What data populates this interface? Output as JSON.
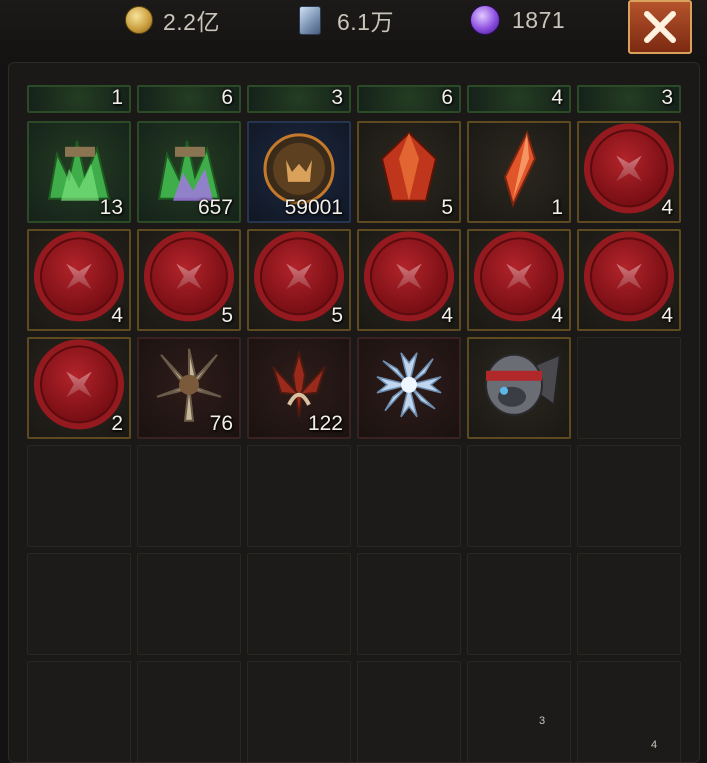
{
  "currencies": {
    "gold": {
      "icon": "gold-coin-icon",
      "value": "2.2亿"
    },
    "cards": {
      "icon": "card-icon",
      "value": "6.1万"
    },
    "orbs": {
      "icon": "purple-orb-icon",
      "value": "1871"
    }
  },
  "close_icon": "close-icon",
  "inventory": {
    "partial_row": [
      "1",
      "6",
      "3",
      "6",
      "4",
      "3"
    ],
    "row1": [
      {
        "name": "green-crystal-cluster-icon",
        "count": "13",
        "frame": "green"
      },
      {
        "name": "green-purple-crystal-icon",
        "count": "657",
        "frame": "green"
      },
      {
        "name": "demon-emblem-icon",
        "count": "59001",
        "frame": "blue"
      },
      {
        "name": "fire-crystal-icon",
        "count": "5",
        "frame": "gold"
      },
      {
        "name": "ember-shard-icon",
        "count": "1",
        "frame": "gold"
      },
      {
        "name": "red-seal-icon",
        "count": "4",
        "frame": "gold"
      }
    ],
    "row2": [
      {
        "name": "red-seal-icon",
        "count": "4",
        "frame": "gold"
      },
      {
        "name": "red-seal-icon",
        "count": "5",
        "frame": "gold"
      },
      {
        "name": "red-seal-icon",
        "count": "5",
        "frame": "gold"
      },
      {
        "name": "red-seal-icon",
        "count": "4",
        "frame": "gold"
      },
      {
        "name": "red-seal-icon",
        "count": "4",
        "frame": "gold"
      },
      {
        "name": "red-seal-icon",
        "count": "4",
        "frame": "gold"
      }
    ],
    "row3": [
      {
        "name": "red-seal-icon",
        "count": "2",
        "frame": "gold"
      },
      {
        "name": "bone-spikes-icon",
        "count": "76",
        "frame": "red"
      },
      {
        "name": "blood-thorn-icon",
        "count": "122",
        "frame": "red"
      },
      {
        "name": "ice-flower-icon",
        "count": "",
        "frame": "red"
      },
      {
        "name": "bandit-helmet-icon",
        "count": "",
        "frame": "gold"
      }
    ]
  },
  "footer_numbers": [
    "3",
    "4"
  ],
  "colors": {
    "accent": "#b5532c",
    "gold_frame": "#5e4a1e",
    "seal_red": "#9a1a20"
  }
}
